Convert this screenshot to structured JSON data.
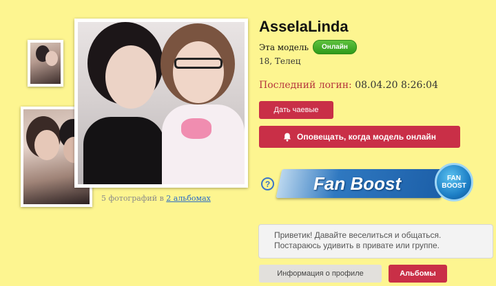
{
  "profile": {
    "name": "AsselaLinda",
    "model_label": "Эта модель",
    "online_badge": "Онлайн",
    "age_sign": "18, Телец",
    "last_login_label": "Последний логин:",
    "last_login_value": "08.04.20 8:26:04"
  },
  "gallery": {
    "caption_prefix": "5 фотографий в",
    "albums_link": "2 альбомах"
  },
  "actions": {
    "tip_label": "Дать чаевые",
    "notify_label": "Оповещать, когда модель онлайн"
  },
  "fanboost": {
    "help_glyph": "?",
    "banner_text": "Fan Boost",
    "badge_line1": "FAN",
    "badge_line2": "BOOST"
  },
  "bio": {
    "line1": "Приветик! Давайте веселиться и общаться.",
    "line2": "Постараюсь удивить в привате или группе."
  },
  "tabs": {
    "info_label": "Информация о профиле",
    "albums_label": "Альбомы"
  },
  "colors": {
    "page_bg": "#fdf590",
    "accent_red": "#c92f47",
    "online_green": "#3fa92a",
    "link_blue": "#2a6cc4"
  }
}
